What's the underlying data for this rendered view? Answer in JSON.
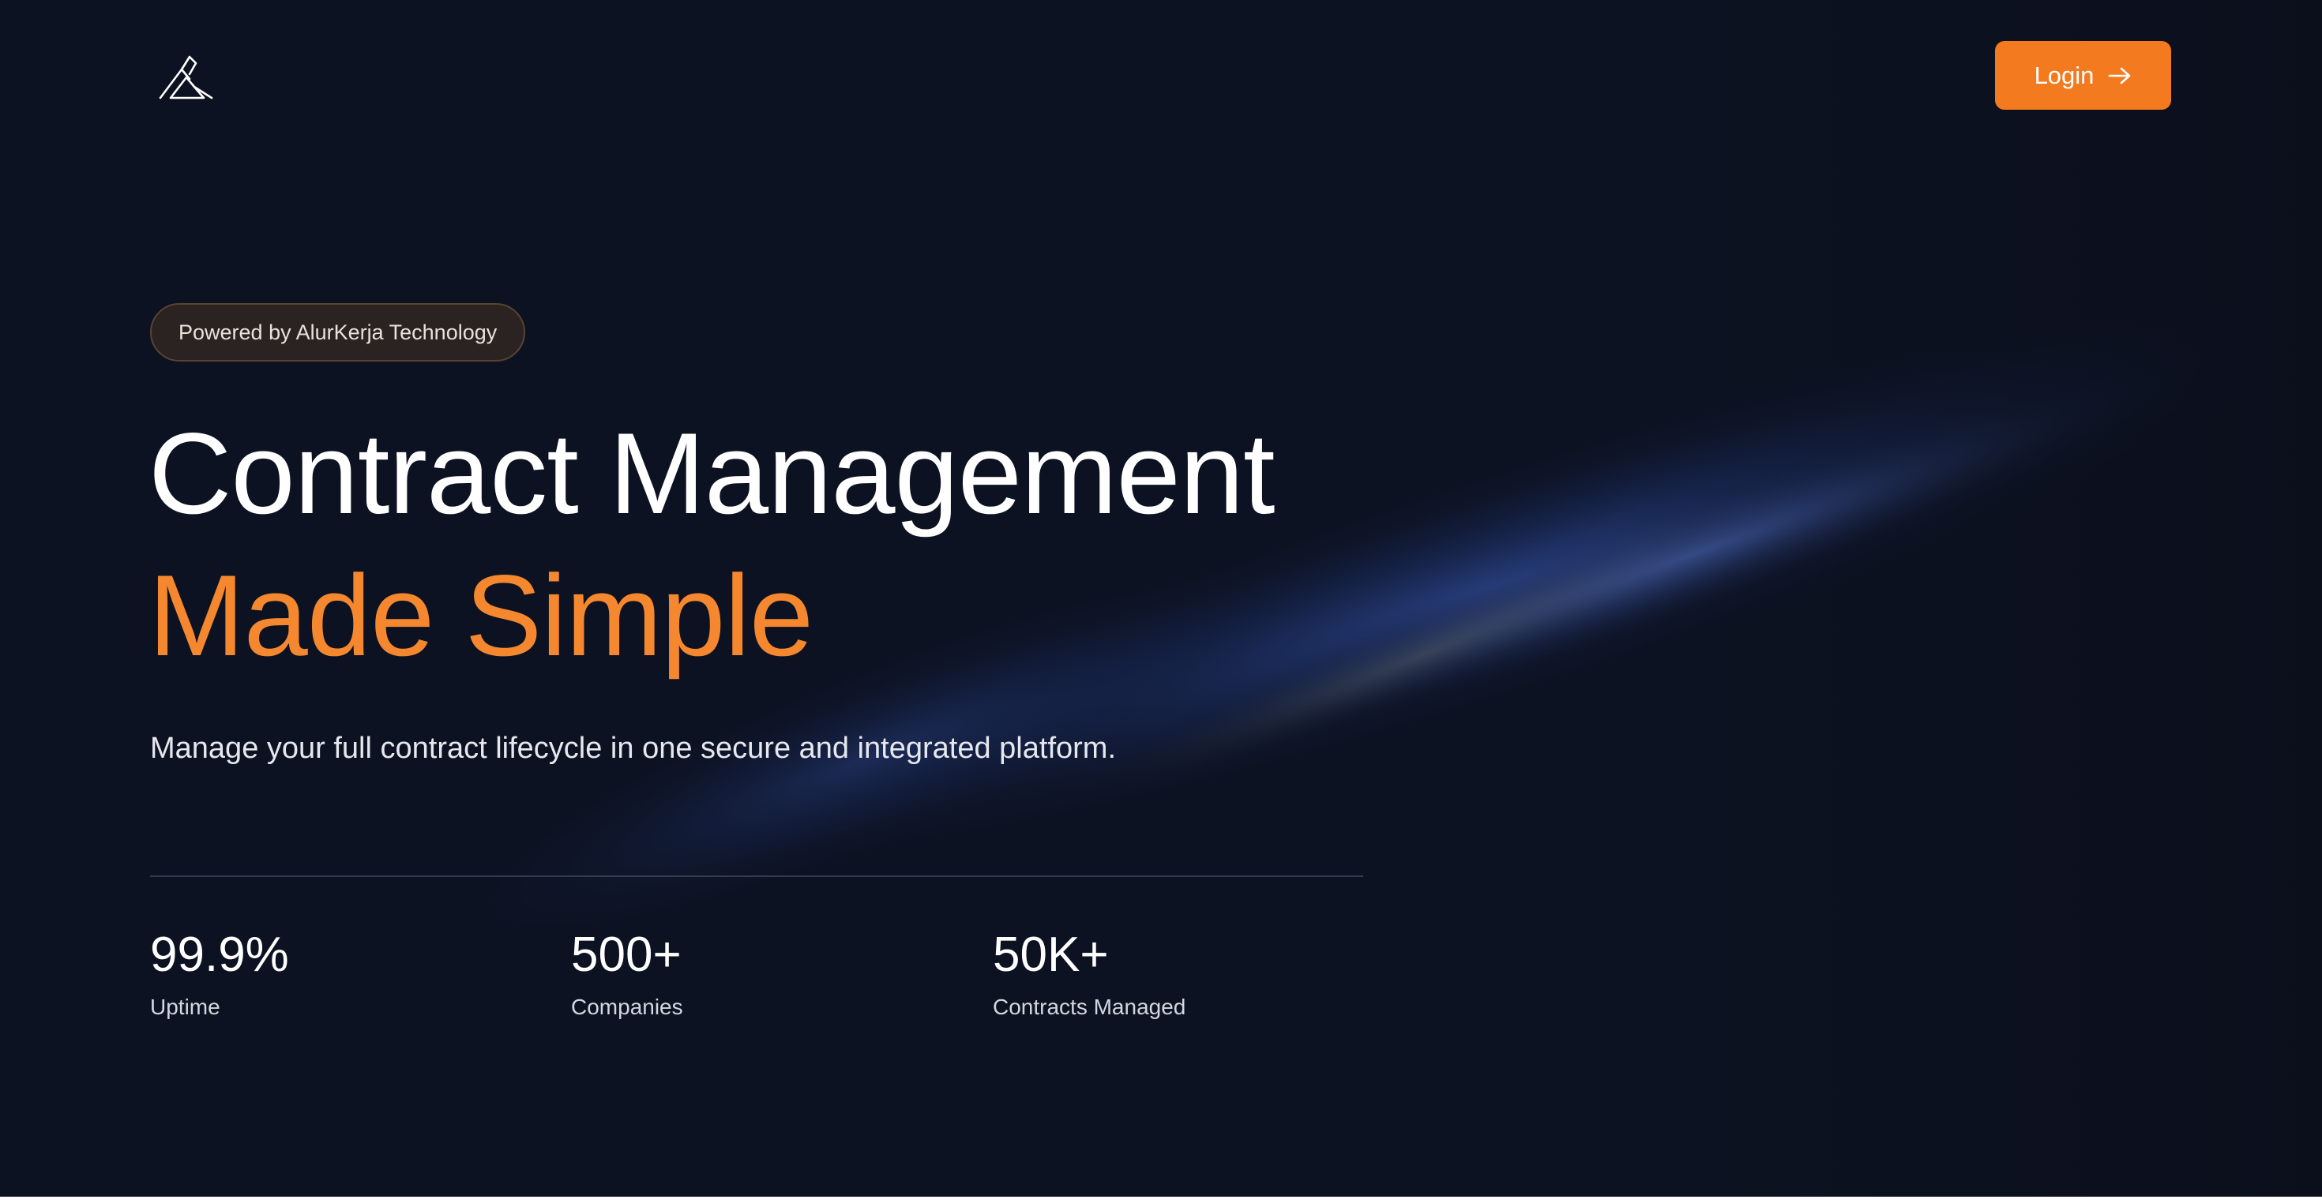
{
  "header": {
    "logo_icon": "alurkerja-logo-icon",
    "login_label": "Login",
    "login_icon": "arrow-right-icon"
  },
  "hero": {
    "badge": "Powered by AlurKerja Technology",
    "title_line1": "Contract Management",
    "title_line2": "Made Simple",
    "subtitle": "Manage your full contract lifecycle in one secure and integrated platform."
  },
  "stats": [
    {
      "value": "99.9%",
      "label": "Uptime"
    },
    {
      "value": "500+",
      "label": "Companies"
    },
    {
      "value": "50K+",
      "label": "Contracts Managed"
    }
  ],
  "colors": {
    "background": "#0d1222",
    "accent": "#f47a1f",
    "title_accent": "#f5882f",
    "badge_background": "#2a2321"
  }
}
